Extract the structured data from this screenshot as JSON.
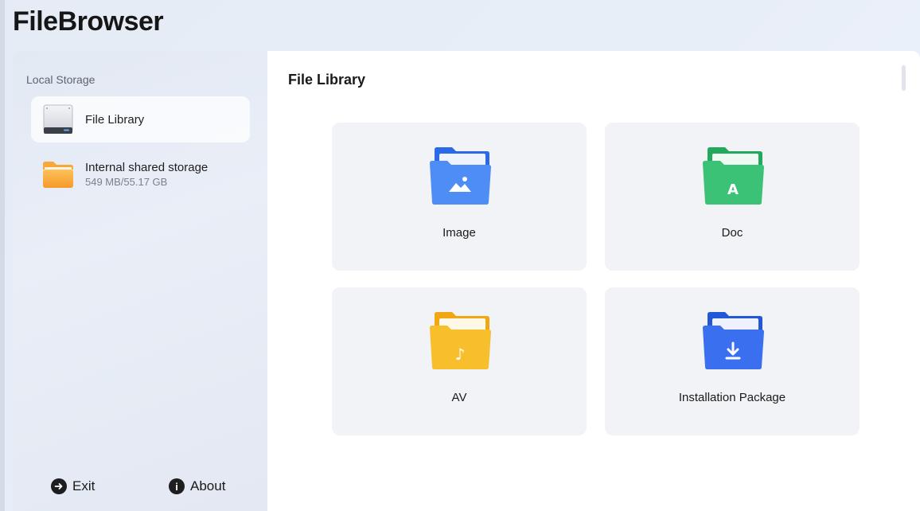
{
  "app": {
    "title": "FileBrowser"
  },
  "sidebar": {
    "section_label": "Local Storage",
    "items": [
      {
        "label": "File Library",
        "sub": "",
        "icon": "hard-drive-icon",
        "selected": true
      },
      {
        "label": "Internal shared storage",
        "sub": "549 MB/55.17 GB",
        "icon": "folder-icon",
        "selected": false
      }
    ],
    "footer": {
      "exit_label": "Exit",
      "exit_icon": "arrow-right-circle-icon",
      "about_label": "About",
      "about_icon": "info-circle-icon",
      "about_glyph": "i"
    }
  },
  "main": {
    "title": "File Library",
    "categories": [
      {
        "label": "Image",
        "icon": "image-folder-icon",
        "color": "#3d7ff0",
        "glyph": ""
      },
      {
        "label": "Doc",
        "icon": "doc-folder-icon",
        "color": "#2fb86a",
        "glyph": "A"
      },
      {
        "label": "AV",
        "icon": "audio-folder-icon",
        "color": "#f2b418",
        "glyph": "♪"
      },
      {
        "label": "Installation Package",
        "icon": "package-folder-icon",
        "color": "#3169ea",
        "glyph": ""
      }
    ]
  }
}
